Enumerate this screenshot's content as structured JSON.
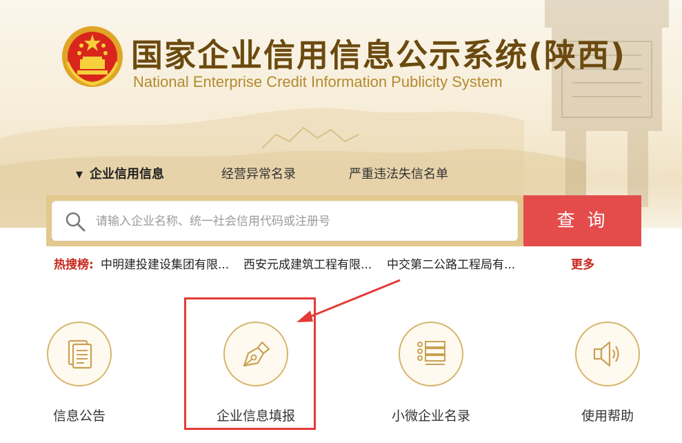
{
  "header": {
    "title_cn": "国家企业信用信息公示系统(陕西)",
    "title_en": "National Enterprise Credit Information Publicity System",
    "emblem": "national-emblem-icon"
  },
  "nav": {
    "items": [
      {
        "label": "企业信用信息",
        "active": true
      },
      {
        "label": "经营异常名录",
        "active": false
      },
      {
        "label": "严重违法失信名单",
        "active": false
      }
    ]
  },
  "search": {
    "placeholder": "请输入企业名称、统一社会信用代码或注册号",
    "button_label": "查询",
    "icon": "search-icon"
  },
  "hot_search": {
    "label": "热搜榜:",
    "items": [
      "中明建投建设集团有限...",
      "西安元成建筑工程有限...",
      "中交第二公路工程局有..."
    ],
    "more": "更多"
  },
  "services": [
    {
      "label": "信息公告",
      "icon": "document-icon"
    },
    {
      "label": "企业信息填报",
      "icon": "pen-nib-icon"
    },
    {
      "label": "小微企业名录",
      "icon": "list-icon"
    },
    {
      "label": "使用帮助",
      "icon": "speaker-icon"
    }
  ],
  "colors": {
    "accent_red": "#e44c4c",
    "gold": "#d6b46a",
    "title_brown": "#6b4a0f",
    "annotation_red": "#e53935"
  }
}
